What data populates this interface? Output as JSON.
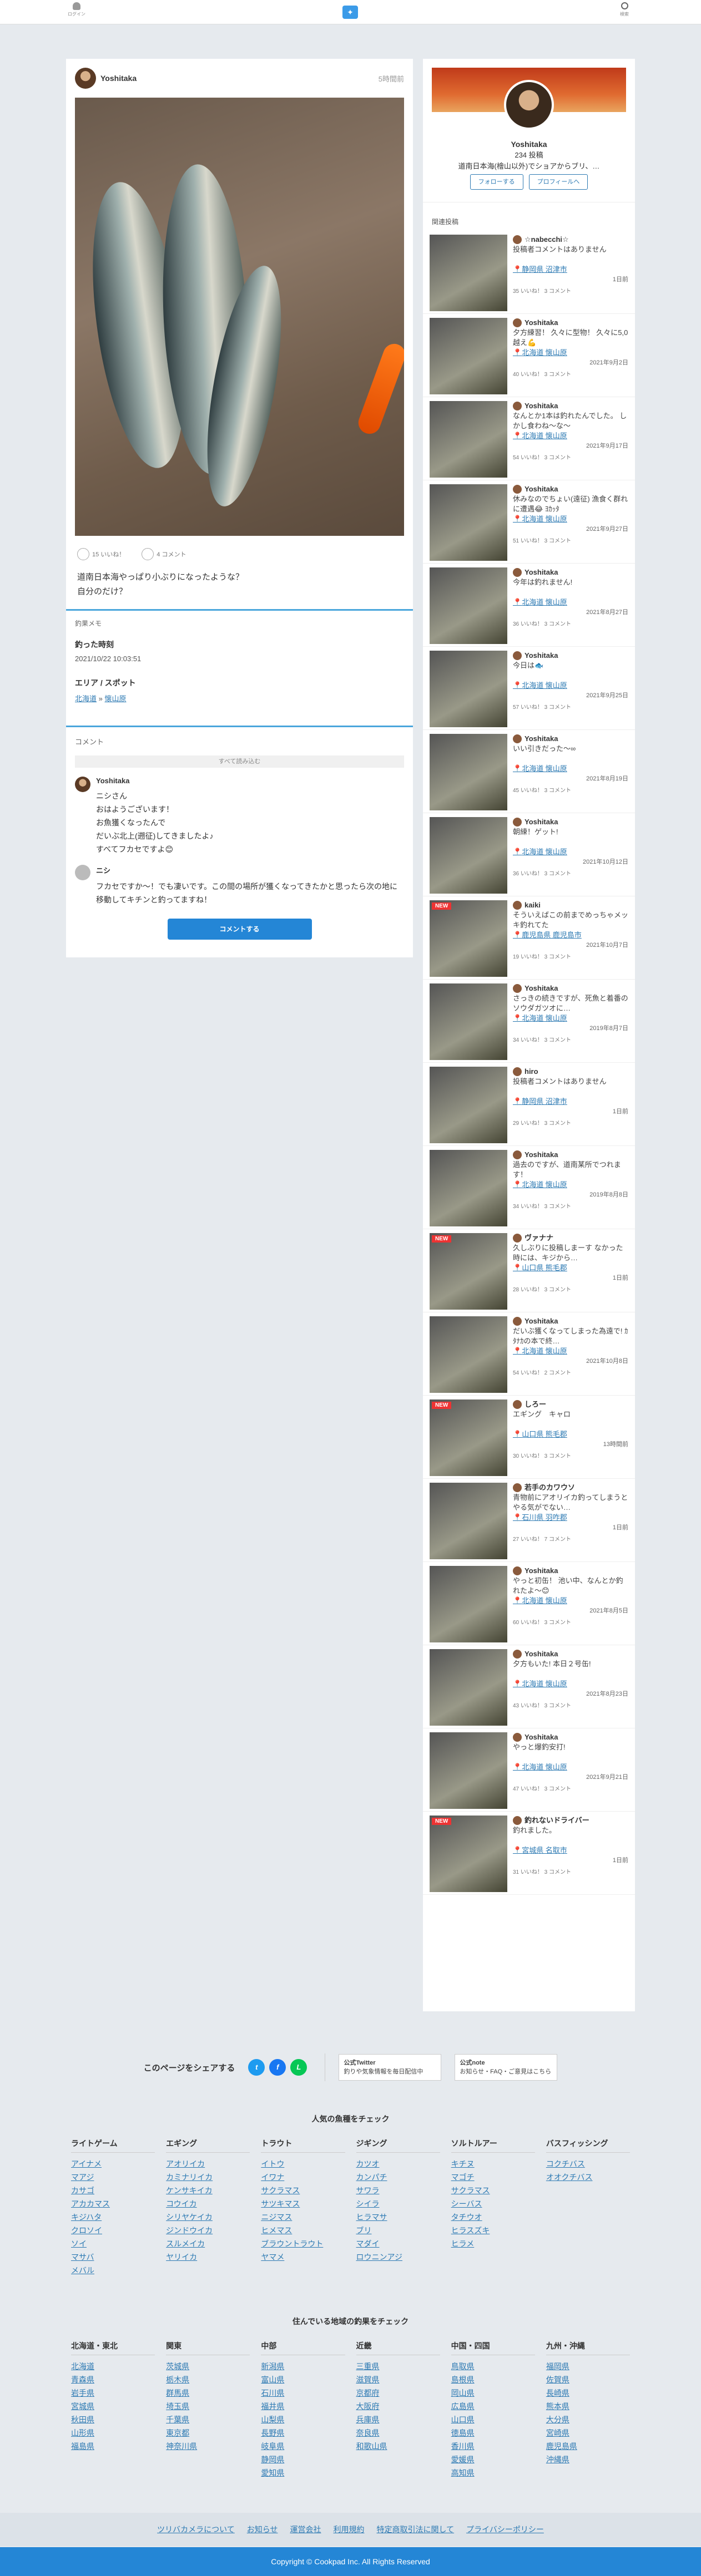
{
  "header": {
    "login": "ログイン",
    "search": "検索"
  },
  "post": {
    "user": "Yoshitaka",
    "time": "5時間前",
    "likes": "15 いいね！",
    "comments": "4 コメント",
    "caption": [
      "道南日本海やっぱり小ぶりになったような？",
      "自分のだけ？"
    ],
    "memo_title": "釣果メモ",
    "time_label": "釣った時刻",
    "time_value": "2021/10/22 10:03:51",
    "area_label": "エリア / スポット",
    "area_pref": "北海道",
    "area_spot": "懐山原",
    "comments_title": "コメント",
    "see_all": "すべて読み込む",
    "c1_name": "Yoshitaka",
    "c1_text": "ニシさん\nおはようございます！\nお魚獲くなったんで\nだいぶ北上(遡征)してきましたよ♪\nすべてフカセですよ😊",
    "c2_name": "ニシ",
    "c2_text": "フカセですか～！でも凄いです。この間の場所が獲くなってきたかと思ったら次の地に移動してキチンと釣ってますね！",
    "comment_btn": "コメントする"
  },
  "profile": {
    "name": "Yoshitaka",
    "posts": "234 投稿",
    "desc": "道南日本海(檜山以外)でショアからブリ、…",
    "follow": "フォローする",
    "view": "プロフィールへ"
  },
  "related_title": "関連投稿",
  "related": [
    {
      "u": "☆nabecchi☆",
      "d": "投稿者コメントはありません",
      "loc": "静岡県 沼津市",
      "dt": "1日前",
      "ct": "35 いいね！  3 コメント",
      "new": ""
    },
    {
      "u": "Yoshitaka",
      "d": "夕方練習！ 久々に型物！ 久々に5,0越え💪",
      "loc": "北海道 懐山原",
      "dt": "2021年9月2日",
      "ct": "40 いいね！  3 コメント",
      "new": ""
    },
    {
      "u": "Yoshitaka",
      "d": "なんとか1本は釣れたんでした。 しかし食わね～な〜",
      "loc": "北海道 懐山原",
      "dt": "2021年9月17日",
      "ct": "54 いいね！  3 コメント",
      "new": ""
    },
    {
      "u": "Yoshitaka",
      "d": "休みなのでちょい(遠征) 漁食く群れに遭遇😂 ﾖｶｯﾀ",
      "loc": "北海道 懐山原",
      "dt": "2021年9月27日",
      "ct": "51 いいね！  3 コメント",
      "new": ""
    },
    {
      "u": "Yoshitaka",
      "d": "今年は釣れません!",
      "loc": "北海道 懐山原",
      "dt": "2021年8月27日",
      "ct": "36 いいね！  3 コメント",
      "new": ""
    },
    {
      "u": "Yoshitaka",
      "d": "今日は🐟",
      "loc": "北海道 懐山原",
      "dt": "2021年9月25日",
      "ct": "57 いいね！  3 コメント",
      "new": ""
    },
    {
      "u": "Yoshitaka",
      "d": "いい引きだった～∞",
      "loc": "北海道 懐山原",
      "dt": "2021年8月19日",
      "ct": "45 いいね！  3 コメント",
      "new": ""
    },
    {
      "u": "Yoshitaka",
      "d": "朝練！ゲット!",
      "loc": "北海道 懐山原",
      "dt": "2021年10月12日",
      "ct": "36 いいね！  3 コメント",
      "new": ""
    },
    {
      "u": "kaiki",
      "d": "そういえばこの前までめっちゃメッキ釣れてた",
      "loc": "鹿児島県 鹿児島市",
      "dt": "2021年10月7日",
      "ct": "19 いいね！  3 コメント",
      "new": "NEW"
    },
    {
      "u": "Yoshitaka",
      "d": "さっきの続きですが、死魚と着番のソウダガツオに…",
      "loc": "北海道 懐山原",
      "dt": "2019年8月7日",
      "ct": "34 いいね！  3 コメント",
      "new": ""
    },
    {
      "u": "hiro",
      "d": "投稿者コメントはありません",
      "loc": "静岡県 沼津市",
      "dt": "1日前",
      "ct": "29 いいね！  3 コメント",
      "new": ""
    },
    {
      "u": "Yoshitaka",
      "d": "過去のですが、道南某所でつれます！",
      "loc": "北海道 懐山原",
      "dt": "2019年8月8日",
      "ct": "34 いいね！  3 コメント",
      "new": ""
    },
    {
      "u": "ヴァナナ",
      "d": "久しぶりに投稿しまーす なかった時には、キジから…",
      "loc": "山口県 熊毛郡",
      "dt": "1日前",
      "ct": "28 いいね！  3 コメント",
      "new": "NEW"
    },
    {
      "u": "Yoshitaka",
      "d": "だいぶ獲くなってしまった為遠で! ｶﾀﾅｶの本で終…",
      "loc": "北海道 懐山原",
      "dt": "2021年10月8日",
      "ct": "54 いいね！  2 コメント",
      "new": ""
    },
    {
      "u": "しろー",
      "d": "エギング　キャロ",
      "loc": "山口県 熊毛郡",
      "dt": "13時間前",
      "ct": "30 いいね！  3 コメント",
      "new": "NEW"
    },
    {
      "u": "若手のカワウソ",
      "d": "青物前にアオリイカ釣ってしまうとやる気がでない…",
      "loc": "石川県 羽咋郡",
      "dt": "1日前",
      "ct": "27 いいね！  7 コメント",
      "new": ""
    },
    {
      "u": "Yoshitaka",
      "d": "やっと初缶！ 池い中、なんとか釣れたよ〜😊",
      "loc": "北海道 懐山原",
      "dt": "2021年8月5日",
      "ct": "60 いいね！  3 コメント",
      "new": ""
    },
    {
      "u": "Yoshitaka",
      "d": "夕方もいた! 本日２号缶!",
      "loc": "北海道 懐山原",
      "dt": "2021年8月23日",
      "ct": "43 いいね！  3 コメント",
      "new": ""
    },
    {
      "u": "Yoshitaka",
      "d": "やっと爆釣安打!",
      "loc": "北海道 懐山原",
      "dt": "2021年9月21日",
      "ct": "47 いいね！  3 コメント",
      "new": ""
    },
    {
      "u": "釣れないドライバー",
      "d": "釣れました。",
      "loc": "宮城県 名取市",
      "dt": "1日前",
      "ct": "31 いいね！  3 コメント",
      "new": "NEW"
    }
  ],
  "share": {
    "title": "このページをシェアする",
    "tw": "公式Twitter",
    "tw_sub": "釣りや気象情報を毎日配信中",
    "note": "公式note",
    "note_sub": "お知らせ・FAQ・ご意見はこちら"
  },
  "fish": {
    "title": "人気の魚種をチェック",
    "cols": [
      {
        "h": "ライトゲーム",
        "i": [
          "アイナメ",
          "マアジ",
          "カサゴ",
          "アカカマス",
          "キジハタ",
          "クロソイ",
          "ソイ",
          "マサバ",
          "メバル"
        ]
      },
      {
        "h": "エギング",
        "i": [
          "アオリイカ",
          "カミナリイカ",
          "ケンサキイカ",
          "コウイカ",
          "シリヤケイカ",
          "ジンドウイカ",
          "スルメイカ",
          "ヤリイカ"
        ]
      },
      {
        "h": "トラウト",
        "i": [
          "イトウ",
          "イワナ",
          "サクラマス",
          "サツキマス",
          "ニジマス",
          "ヒメマス",
          "ブラウントラウト",
          "ヤマメ"
        ]
      },
      {
        "h": "ジギング",
        "i": [
          "カツオ",
          "カンパチ",
          "サワラ",
          "シイラ",
          "ヒラマサ",
          "ブリ",
          "マダイ",
          "ロウニンアジ"
        ]
      },
      {
        "h": "ソルトルアー",
        "i": [
          "キチヌ",
          "マゴチ",
          "サクラマス",
          "シーバス",
          "タチウオ",
          "ヒラスズキ",
          "ヒラメ"
        ]
      },
      {
        "h": "バスフィッシング",
        "i": [
          "コクチバス",
          "オオクチバス"
        ]
      }
    ]
  },
  "area": {
    "title": "住んでいる地域の釣果をチェック",
    "cols": [
      {
        "h": "北海道・東北",
        "i": [
          "北海道",
          "青森県",
          "岩手県",
          "宮城県",
          "秋田県",
          "山形県",
          "福島県"
        ]
      },
      {
        "h": "関東",
        "i": [
          "茨城県",
          "栃木県",
          "群馬県",
          "埼玉県",
          "千葉県",
          "東京都",
          "神奈川県"
        ]
      },
      {
        "h": "中部",
        "i": [
          "新潟県",
          "富山県",
          "石川県",
          "福井県",
          "山梨県",
          "長野県",
          "岐阜県",
          "静岡県",
          "愛知県"
        ]
      },
      {
        "h": "近畿",
        "i": [
          "三重県",
          "滋賀県",
          "京都府",
          "大阪府",
          "兵庫県",
          "奈良県",
          "和歌山県"
        ]
      },
      {
        "h": "中国・四国",
        "i": [
          "鳥取県",
          "島根県",
          "岡山県",
          "広島県",
          "山口県",
          "徳島県",
          "香川県",
          "愛媛県",
          "高知県"
        ]
      },
      {
        "h": "九州・沖縄",
        "i": [
          "福岡県",
          "佐賀県",
          "長崎県",
          "熊本県",
          "大分県",
          "宮崎県",
          "鹿児島県",
          "沖縄県"
        ]
      }
    ]
  },
  "footer": {
    "links": [
      "ツリバカメラについて",
      "お知らせ",
      "運営会社",
      "利用規約",
      "特定商取引法に関して",
      "プライバシーポリシー"
    ],
    "copy": "Copyright © Cookpad Inc. All Rights Reserved"
  }
}
